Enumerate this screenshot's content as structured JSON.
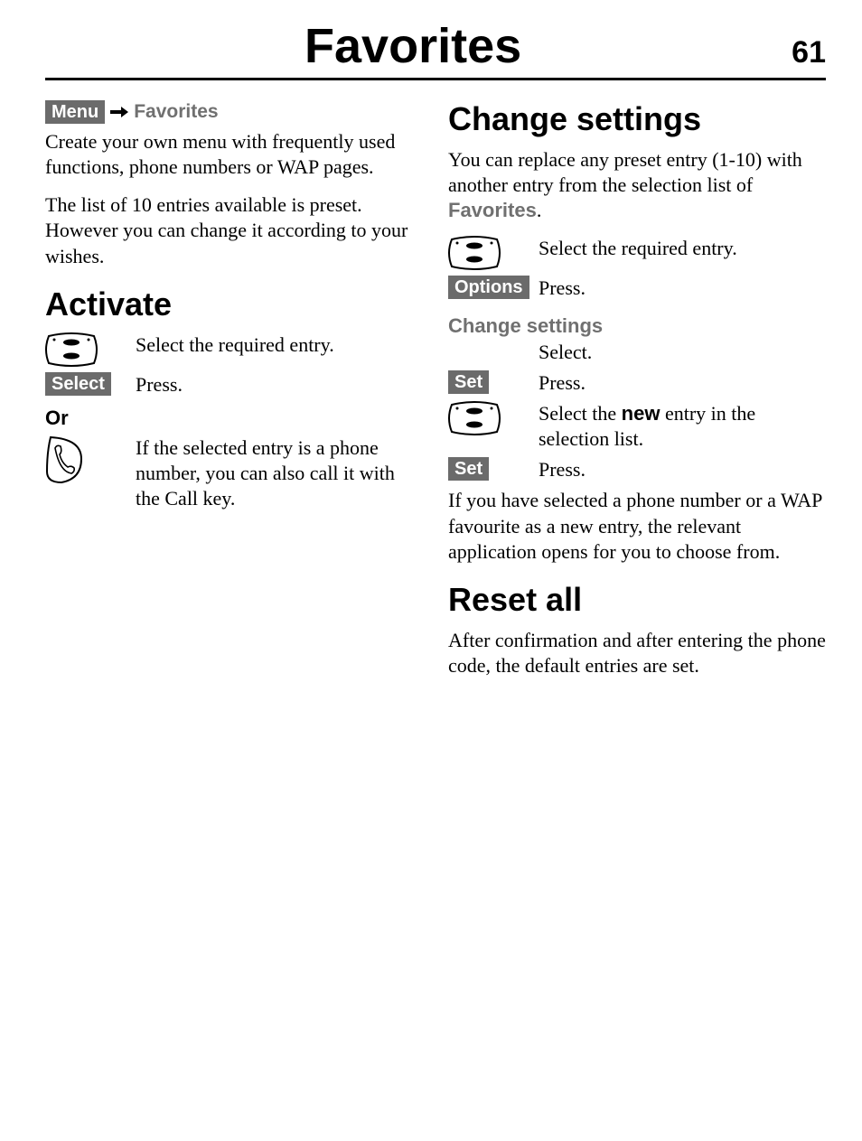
{
  "header": {
    "title": "Favorites",
    "pageNumber": "61"
  },
  "left": {
    "breadcrumb": {
      "menu": "Menu",
      "dest": "Favorites"
    },
    "intro1": "Create your own menu with frequently used functions, phone numbers or WAP pages.",
    "intro2": "The list of 10 entries available is preset. However you can change it according to your wishes.",
    "activate": {
      "heading": "Activate",
      "row1": "Select the required entry.",
      "selectKey": "Select",
      "row2": "Press.",
      "or": "Or",
      "row3": "If the selected entry is a phone number, you can also call it with the Call key."
    }
  },
  "right": {
    "change": {
      "heading": "Change settings",
      "intro_a": "You can replace any preset entry (1-10) with another entry from the selection list of ",
      "intro_b": "Favorites",
      "intro_c": ".",
      "row1": "Select the required entry.",
      "optionsKey": "Options",
      "row2": "Press.",
      "subheading": "Change settings",
      "row3": "Select.",
      "setKey1": "Set",
      "row4": "Press.",
      "row5a": "Select the ",
      "row5b": "new",
      "row5c": " entry in the selection list.",
      "setKey2": "Set",
      "row6": "Press.",
      "outro": "If you have selected a phone number or a WAP favourite as a new entry, the relevant application opens for you to choose from."
    },
    "reset": {
      "heading": "Reset all",
      "body": "After confirmation and after entering the phone code, the default entries are set."
    }
  }
}
